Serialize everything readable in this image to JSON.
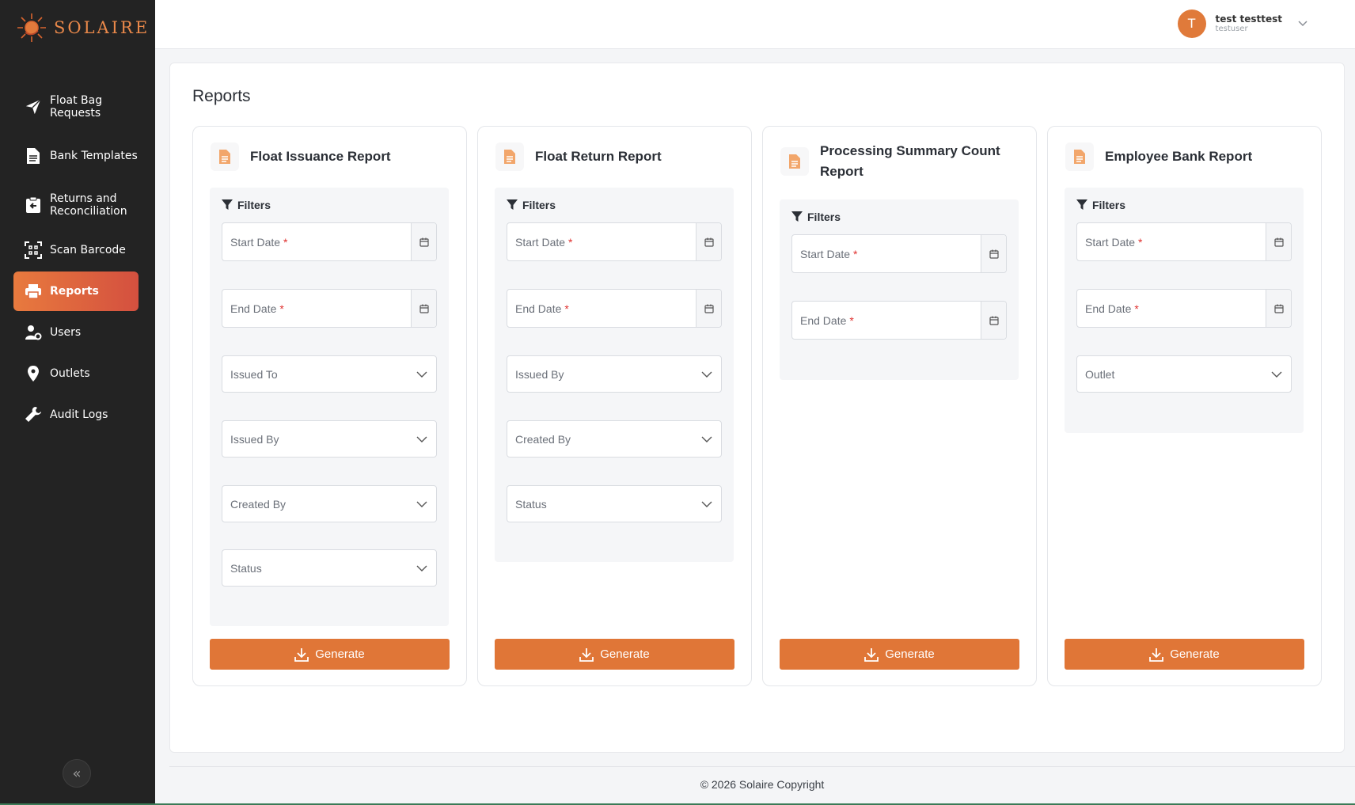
{
  "brand": {
    "name": "SOLAIRE",
    "accent": "#e07637"
  },
  "sidebar": {
    "items": [
      {
        "label": "Float Bag Requests",
        "icon": "paper-plane-icon"
      },
      {
        "label": "Bank Templates",
        "icon": "document-icon"
      },
      {
        "label": "Returns and Reconciliation",
        "icon": "clipboard-return-icon"
      },
      {
        "label": "Scan Barcode",
        "icon": "barcode-scan-icon"
      },
      {
        "label": "Reports",
        "icon": "printer-icon",
        "active": true
      },
      {
        "label": "Users",
        "icon": "users-gear-icon"
      },
      {
        "label": "Outlets",
        "icon": "location-pin-icon"
      },
      {
        "label": "Audit Logs",
        "icon": "wrench-icon"
      }
    ],
    "collapse_glyph": "«"
  },
  "user": {
    "initial": "T",
    "name": "test testtest",
    "handle": "testuser"
  },
  "page": {
    "title": "Reports"
  },
  "common": {
    "filters_label": "Filters",
    "generate_label": "Generate"
  },
  "cards": [
    {
      "title": "Float Issuance Report",
      "fields": {
        "start_date": "Start Date",
        "end_date": "End Date",
        "issued_to": "Issued To",
        "issued_by": "Issued By",
        "created_by": "Created By",
        "status": "Status"
      }
    },
    {
      "title": "Float Return Report",
      "fields": {
        "start_date": "Start Date",
        "end_date": "End Date",
        "issued_by": "Issued By",
        "created_by": "Created By",
        "status": "Status"
      }
    },
    {
      "title": "Processing Summary Count Report",
      "fields": {
        "start_date": "Start Date",
        "end_date": "End Date"
      }
    },
    {
      "title": "Employee Bank Report",
      "fields": {
        "start_date": "Start Date",
        "end_date": "End Date",
        "outlet": "Outlet"
      }
    }
  ],
  "footer": {
    "text": "© 2026 Solaire Copyright"
  }
}
